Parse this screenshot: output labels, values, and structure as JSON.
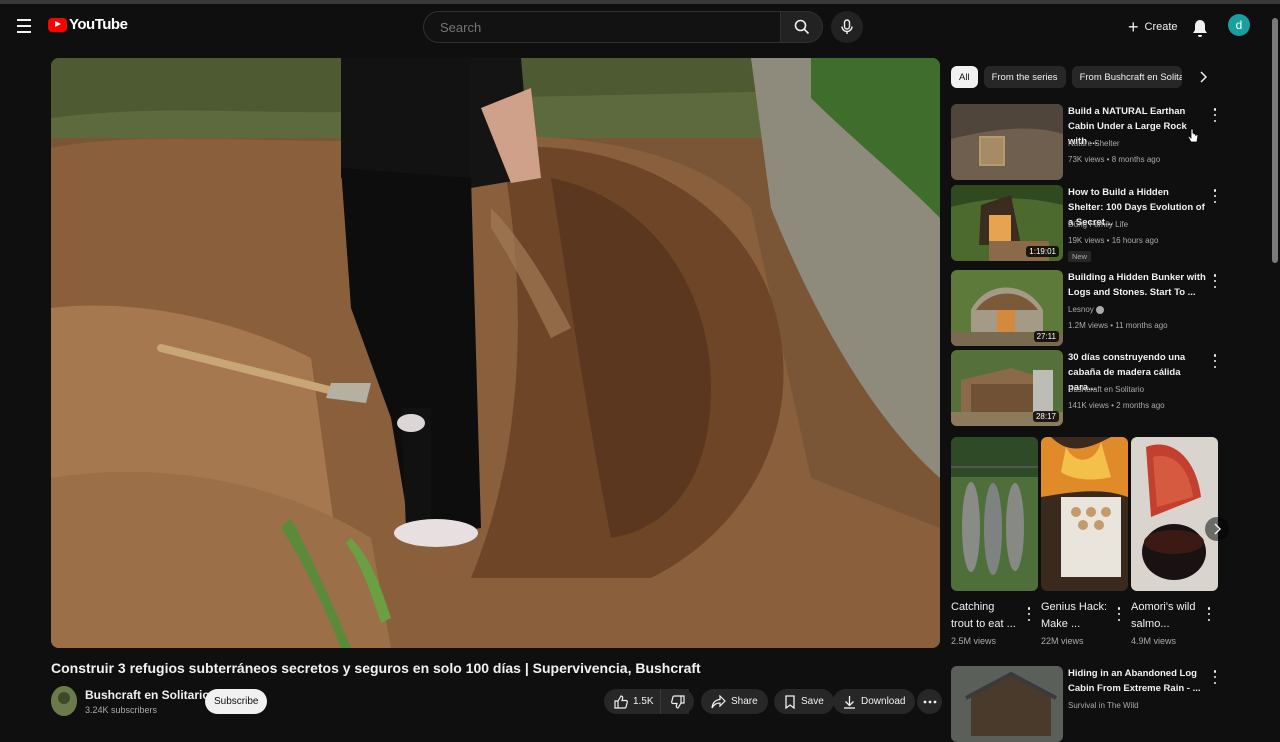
{
  "header": {
    "logo_text": "YouTube",
    "search_placeholder": "Search",
    "create_label": "Create",
    "avatar_letter": "d"
  },
  "video": {
    "title": "Construir 3 refugios subterráneos secretos y seguros en solo 100 días | Supervivencia, Bushcraft",
    "channel": "Bushcraft en Solitario",
    "subscribers": "3.24K subscribers",
    "subscribe_label": "Subscribe",
    "likes": "1.5K",
    "share_label": "Share",
    "save_label": "Save",
    "download_label": "Download"
  },
  "chips": [
    {
      "label": "All",
      "active": true
    },
    {
      "label": "From the series",
      "active": false
    },
    {
      "label": "From Bushcraft en Solitario",
      "active": false
    }
  ],
  "recommendations": [
    {
      "title": "Build a NATURAL Earthan Cabin Under a Large Rock with ...",
      "channel": "Nature Shelter",
      "meta": "73K views • 8 months ago",
      "duration": "",
      "badge": ""
    },
    {
      "title": "How to Build a Hidden Shelter: 100 Days Evolution of a Secret...",
      "channel": "Dũng Family Life",
      "meta": "19K views • 16 hours ago",
      "duration": "1:19:01",
      "badge": "New"
    },
    {
      "title": "Building a Hidden Bunker with Logs and Stones. Start To ...",
      "channel": "Lesnoy",
      "meta": "1.2M views • 11 months ago",
      "duration": "27:11",
      "badge": ""
    },
    {
      "title": "30 días construyendo una cabaña de madera cálida para...",
      "channel": "Bushcraft en Solitario",
      "meta": "141K views • 2 months ago",
      "duration": "28:17",
      "badge": ""
    },
    {
      "title": "Hiding in an Abandoned Log Cabin From Extreme Rain - ...",
      "channel": "Survival in The Wild",
      "meta": "",
      "duration": "",
      "badge": ""
    }
  ],
  "shorts": [
    {
      "title": "Catching trout to eat ...",
      "views": "2.5M views"
    },
    {
      "title": "Genius Hack: Make ...",
      "views": "22M views"
    },
    {
      "title": "Aomori's wild salmo...",
      "views": "4.9M views"
    }
  ]
}
